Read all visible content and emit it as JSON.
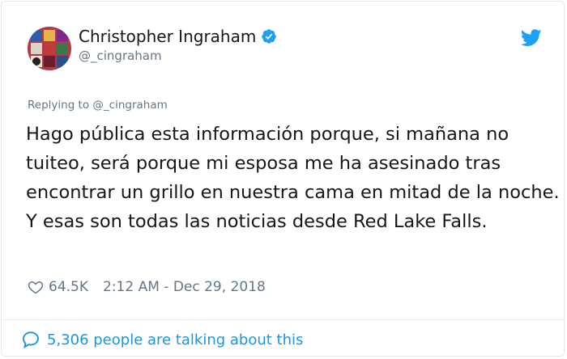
{
  "user": {
    "display_name": "Christopher Ingraham",
    "handle": "@_cingraham",
    "avatar_icon": "profile-avatar",
    "verified_icon": "verified-badge-icon"
  },
  "tweet": {
    "replying_to": "Replying to @_cingraham",
    "text": "Hago pública esta información porque, si mañana no tuiteo, será porque mi esposa me ha asesinado tras encontrar un grillo en nuestra cama en mitad de la noche.\nY esas son todas las noticias desde Red Lake Falls.",
    "likes": "64.5K",
    "timestamp": "2:12 AM - Dec 29, 2018"
  },
  "footer": {
    "talking_label": "5,306 people are talking about this"
  },
  "colors": {
    "brand_blue": "#1da1f2",
    "link_blue": "#1b95e0",
    "muted": "#657786",
    "border": "#e1e8ed"
  }
}
